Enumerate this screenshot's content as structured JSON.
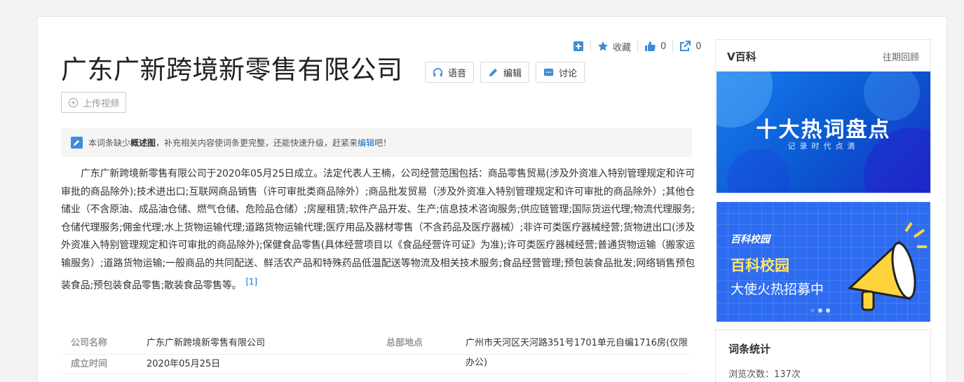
{
  "toolbar": {
    "collect_label": "收藏",
    "like_count": "0",
    "share_count": "0"
  },
  "title": "广东广新跨境新零售有限公司",
  "title_buttons": {
    "voice": "语音",
    "edit": "编辑",
    "discuss": "讨论"
  },
  "upload_video": "上传视频",
  "notice": {
    "prefix": "本词条缺少",
    "bold": "概述图",
    "middle": "，补充相关内容使词条更完整，还能快速升级，赶紧来",
    "link": "编辑",
    "suffix": "吧！"
  },
  "summary": {
    "text": "广东广新跨境新零售有限公司于2020年05月25日成立。法定代表人王楠，公司经营范围包括：商品零售贸易(涉及外资准入特别管理规定和许可审批的商品除外);技术进出口;互联网商品销售（许可审批类商品除外）;商品批发贸易（涉及外资准入特别管理规定和许可审批的商品除外）;其他仓储业（不含原油、成品油仓储、燃气仓储、危险品仓储）;房屋租赁;软件产品开发、生产;信息技术咨询服务;供应链管理;国际货运代理;物流代理服务;仓储代理服务;佣金代理;水上货物运输代理;道路货物运输代理;医疗用品及器材零售（不含药品及医疗器械）;非许可类医疗器械经营;货物进出口(涉及外资准入特别管理规定和许可审批的商品除外);保健食品零售(具体经营项目以《食品经营许可证》为准);许可类医疗器械经营;普通货物运输（搬家运输服务）;道路货物运输;一般商品的共同配送、鲜活农产品和特殊药品低温配送等物流及相关技术服务;食品经营管理;预包装食品批发;网络销售预包装食品;预包装食品零售;散装食品零售等。",
    "ref": "[1]"
  },
  "infobox": {
    "company_name_label": "公司名称",
    "company_name_value": "广东广新跨境新零售有限公司",
    "hq_label": "总部地点",
    "hq_value": "广州市天河区天河路351号1701单元自编1716房(仅限办公)",
    "founded_label": "成立时间",
    "founded_value": "2020年05月25日"
  },
  "sidebar": {
    "title": "V百科",
    "link": "往期回顾",
    "banner1_title": "十大热词盘点",
    "banner1_sub": "记录时代点滴",
    "banner2_logo": "百科校园",
    "banner2_title": "百科校园",
    "banner2_sub": "大使火热招募中",
    "stats_title": "词条统计",
    "views_label": "浏览次数：137次"
  },
  "colors": {
    "accent_blue": "#136ec2",
    "icon_blue": "#3f8cd9"
  }
}
